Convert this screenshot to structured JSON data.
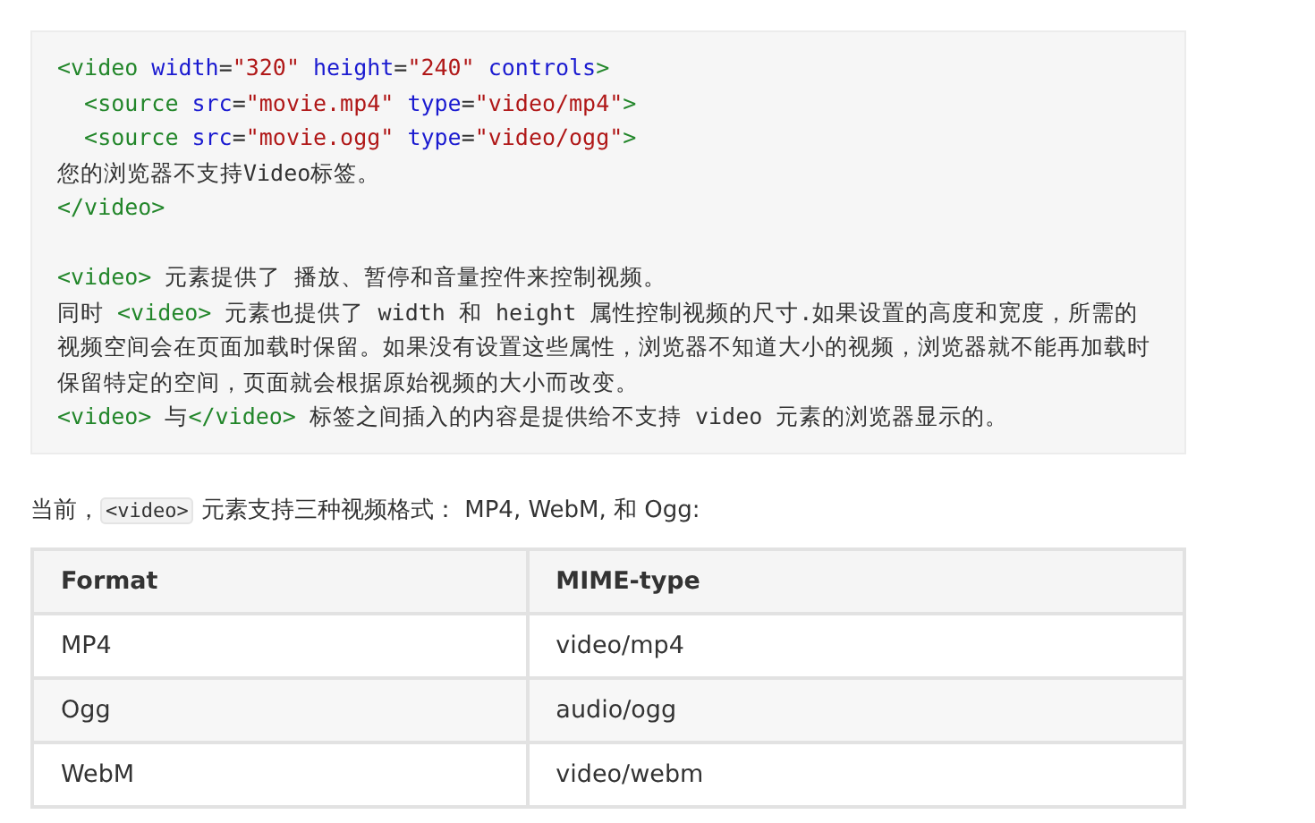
{
  "code_block": {
    "lines": [
      {
        "tokens": [
          {
            "kind": "tag",
            "text": "<video"
          },
          {
            "kind": "attr",
            "text": " width"
          },
          {
            "kind": "plain",
            "text": "="
          },
          {
            "kind": "value",
            "text": "\"320\""
          },
          {
            "kind": "attr",
            "text": " height"
          },
          {
            "kind": "plain",
            "text": "="
          },
          {
            "kind": "value",
            "text": "\"240\""
          },
          {
            "kind": "attr",
            "text": " controls"
          },
          {
            "kind": "tag",
            "text": ">"
          }
        ]
      },
      {
        "indented": true,
        "tokens": [
          {
            "kind": "tag",
            "text": "<source"
          },
          {
            "kind": "attr",
            "text": " src"
          },
          {
            "kind": "plain",
            "text": "="
          },
          {
            "kind": "value",
            "text": "\"movie.mp4\""
          },
          {
            "kind": "attr",
            "text": " type"
          },
          {
            "kind": "plain",
            "text": "="
          },
          {
            "kind": "value",
            "text": "\"video/mp4\""
          },
          {
            "kind": "tag",
            "text": ">"
          }
        ]
      },
      {
        "indented": true,
        "tokens": [
          {
            "kind": "tag",
            "text": "<source"
          },
          {
            "kind": "attr",
            "text": " src"
          },
          {
            "kind": "plain",
            "text": "="
          },
          {
            "kind": "value",
            "text": "\"movie.ogg\""
          },
          {
            "kind": "attr",
            "text": " type"
          },
          {
            "kind": "plain",
            "text": "="
          },
          {
            "kind": "value",
            "text": "\"video/ogg\""
          },
          {
            "kind": "tag",
            "text": ">"
          }
        ]
      },
      {
        "tokens": [
          {
            "kind": "plain",
            "text": "您的浏览器不支持Video标签。"
          }
        ]
      },
      {
        "tokens": [
          {
            "kind": "tag",
            "text": "</video>"
          }
        ]
      },
      {
        "gap_before": true,
        "tokens": [
          {
            "kind": "tag",
            "text": "<video>"
          },
          {
            "kind": "plain",
            "text": " 元素提供了 播放、暂停和音量控件来控制视频。"
          }
        ]
      },
      {
        "tokens": [
          {
            "kind": "plain",
            "text": "同时 "
          },
          {
            "kind": "tag",
            "text": "<video>"
          },
          {
            "kind": "plain",
            "text": " 元素也提供了 width 和 height 属性控制视频的尺寸.如果设置的高度和宽度，所需的视频空间会在页面加载时保留。如果没有设置这些属性，浏览器不知道大小的视频，浏览器就不能再加载时保留特定的空间，页面就会根据原始视频的大小而改变。"
          }
        ]
      },
      {
        "tokens": [
          {
            "kind": "tag",
            "text": "<video>"
          },
          {
            "kind": "plain",
            "text": " 与"
          },
          {
            "kind": "tag",
            "text": "</video>"
          },
          {
            "kind": "plain",
            "text": " 标签之间插入的内容是提供给不支持 video 元素的浏览器显示的。"
          }
        ]
      }
    ]
  },
  "intro": [
    {
      "kind": "plain",
      "text": "当前，"
    },
    {
      "kind": "code",
      "text": "<video>"
    },
    {
      "kind": "plain",
      "text": " 元素支持三种视频格式： MP4, WebM, 和 Ogg:"
    }
  ],
  "table": {
    "columns": [
      "Format",
      "MIME-type"
    ],
    "rows": [
      [
        "MP4",
        "video/mp4"
      ],
      [
        "Ogg",
        "audio/ogg"
      ],
      [
        "WebM",
        "video/webm"
      ]
    ]
  }
}
